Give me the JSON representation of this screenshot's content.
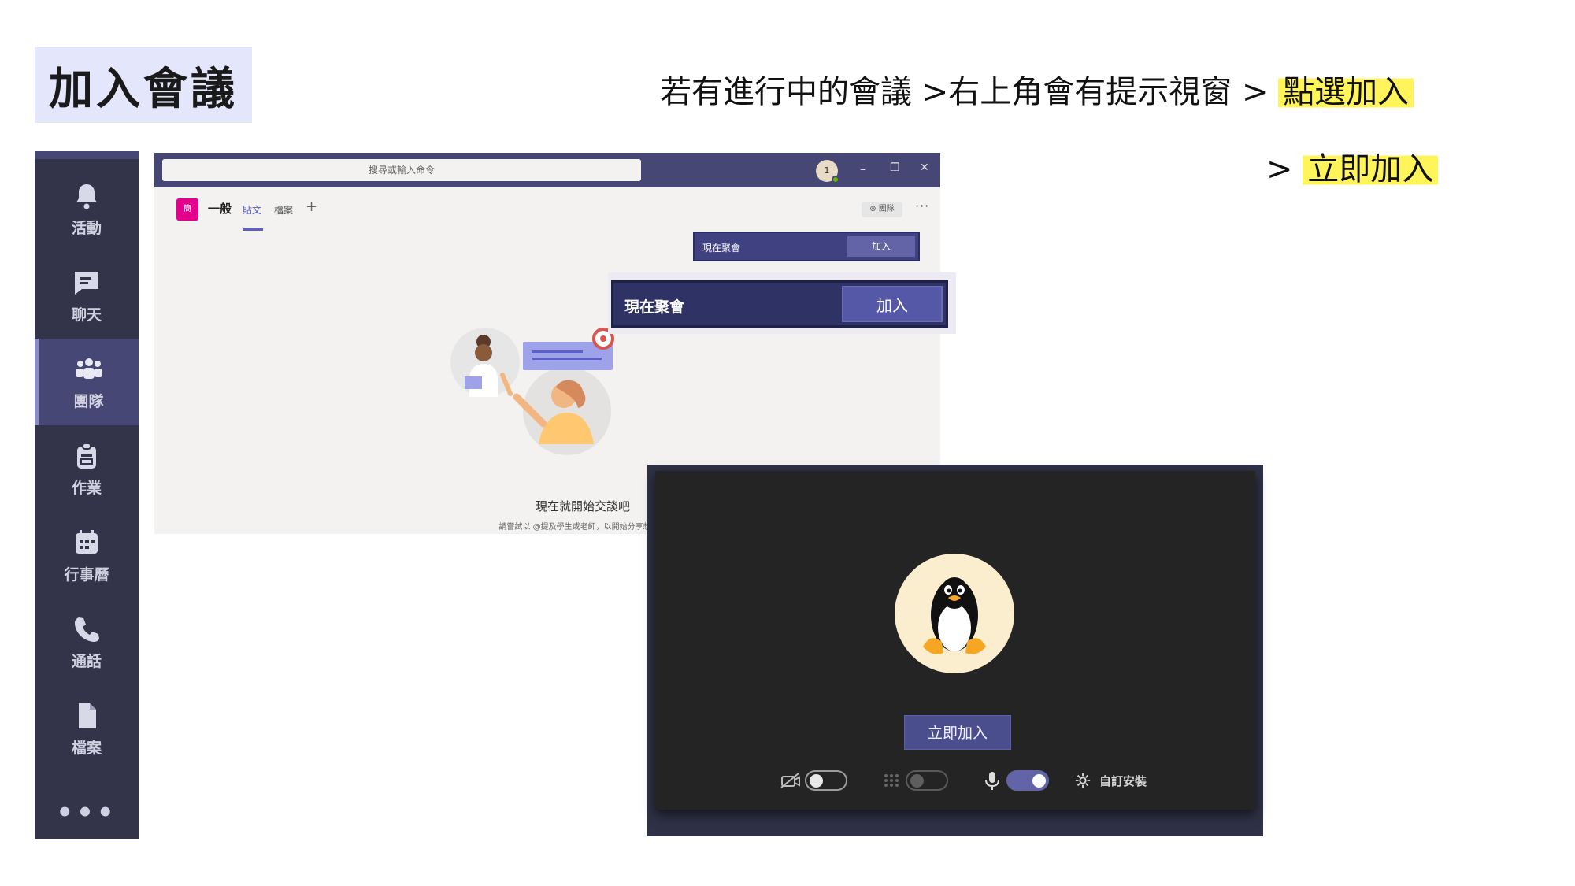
{
  "slide": {
    "title": "加入會議",
    "instruction_line1_prefix": "若有進行中的會議 >右上角會有提示視窗 > ",
    "instruction_line1_highlight": "點選加入",
    "instruction_line2_prefix": "> ",
    "instruction_line2_highlight": "立即加入",
    "highlight_color": "#fff45a"
  },
  "rail": {
    "items": [
      {
        "label": "活動",
        "icon": "bell-icon"
      },
      {
        "label": "聊天",
        "icon": "chat-icon"
      },
      {
        "label": "團隊",
        "icon": "teams-icon",
        "active": true
      },
      {
        "label": "作業",
        "icon": "assignments-icon"
      },
      {
        "label": "行事曆",
        "icon": "calendar-icon"
      },
      {
        "label": "通話",
        "icon": "phone-icon"
      },
      {
        "label": "檔案",
        "icon": "file-icon"
      }
    ],
    "more": "•••"
  },
  "teams_window": {
    "search_placeholder": "搜尋或輸入命令",
    "avatar_initial": "1",
    "window_controls": {
      "minimize": "–",
      "restore": "❐",
      "close": "✕"
    },
    "channel_icon_text": "簡",
    "channel_name": "一般",
    "tabs": [
      "貼文",
      "檔案"
    ],
    "tab_add": "+",
    "team_button": "⊚ 團隊",
    "more": "···",
    "meet_banner": {
      "label": "現在聚會",
      "button": "加入"
    },
    "empty_title": "現在就開始交談吧",
    "empty_subtitle": "請嘗試以 @提及學生或老師，以開始分享想法。"
  },
  "zoomed_banner": {
    "label": "現在聚會",
    "button": "加入"
  },
  "prejoin": {
    "join_button": "立即加入",
    "settings_label": "自訂安裝",
    "video_enabled": false,
    "blur_enabled": false,
    "mic_enabled": true
  },
  "colors": {
    "teams_purple": "#464775",
    "rail_bg": "#33344a",
    "button_purple": "#6264a7",
    "dark_panel": "#242424"
  }
}
